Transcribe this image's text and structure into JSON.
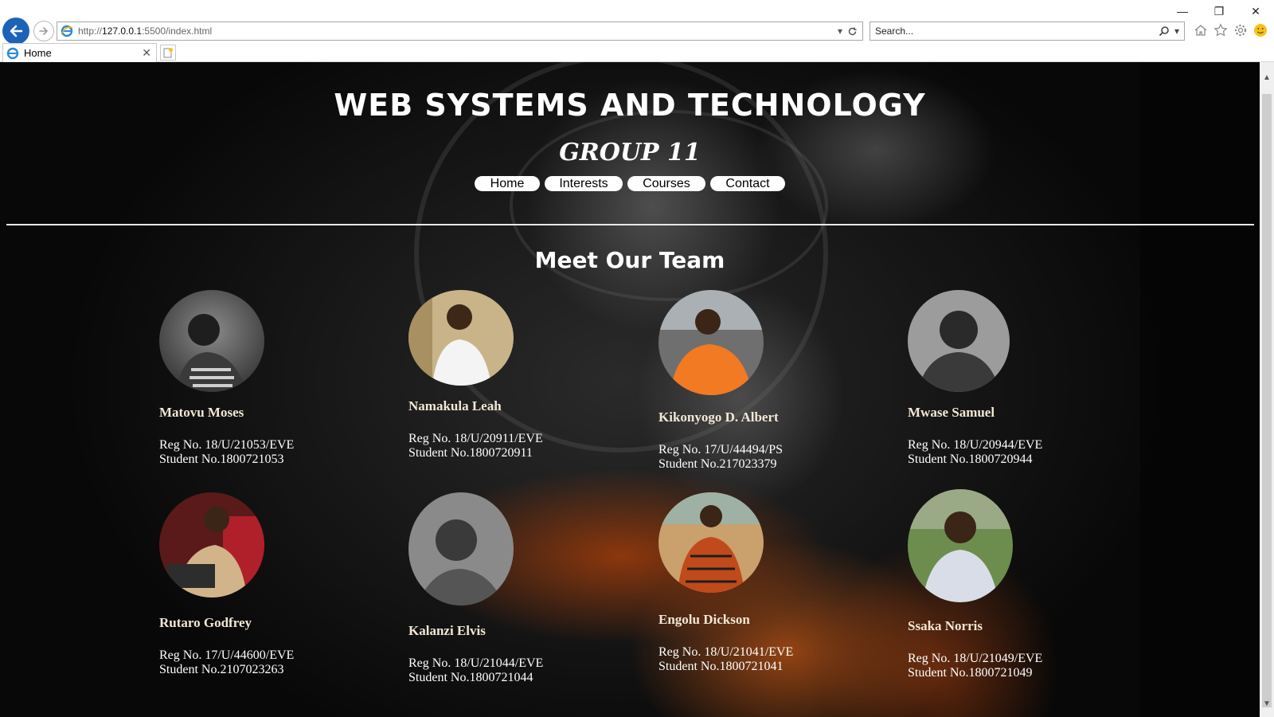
{
  "browser": {
    "url_prefix": "http://",
    "url_host": "127.0.0.1",
    "url_rest": ":5500/index.html",
    "search_placeholder": "Search...",
    "tab_title": "Home",
    "icons": [
      "back-arrow-icon",
      "forward-arrow-icon",
      "ie-logo-icon",
      "dropdown-icon",
      "refresh-icon",
      "search-icon",
      "home-icon",
      "favorites-star-icon",
      "settings-gear-icon",
      "smiley-icon",
      "minimize-icon",
      "restore-icon",
      "close-icon"
    ]
  },
  "site": {
    "title": "WEB SYSTEMS AND TECHNOLOGY",
    "subtitle": "GROUP 11",
    "nav": [
      "Home",
      "Interests",
      "Courses",
      "Contact"
    ],
    "section_heading": "Meet Our Team"
  },
  "members": [
    {
      "name": "Matovu Moses",
      "reg": "Reg No. 18/U/21053/EVE",
      "student": "Student No.1800721053"
    },
    {
      "name": "Namakula Leah",
      "reg": "Reg No. 18/U/20911/EVE",
      "student": "Student No.1800720911"
    },
    {
      "name": "Kikonyogo D. Albert",
      "reg": "Reg No. 17/U/44494/PS",
      "student": "Student No.217023379"
    },
    {
      "name": "Mwase Samuel",
      "reg": "Reg No. 18/U/20944/EVE",
      "student": "Student No.1800720944"
    },
    {
      "name": "Rutaro Godfrey",
      "reg": "Reg No. 17/U/44600/EVE",
      "student": "Student No.2107023263"
    },
    {
      "name": "Kalanzi Elvis",
      "reg": "Reg No. 18/U/21044/EVE",
      "student": "Student No.1800721044"
    },
    {
      "name": "Engolu Dickson",
      "reg": "Reg No. 18/U/21041/EVE",
      "student": "Student No.1800721041"
    },
    {
      "name": "Ssaka Norris",
      "reg": "Reg No. 18/U/21049/EVE",
      "student": "Student No.1800721049"
    }
  ],
  "colors": {
    "browser_accent": "#1c62b8",
    "page_background": "#0b0b0b",
    "heading_text": "#ffffff",
    "member_name": "#f3e7d5",
    "nav_button_bg": "#ffffff"
  }
}
